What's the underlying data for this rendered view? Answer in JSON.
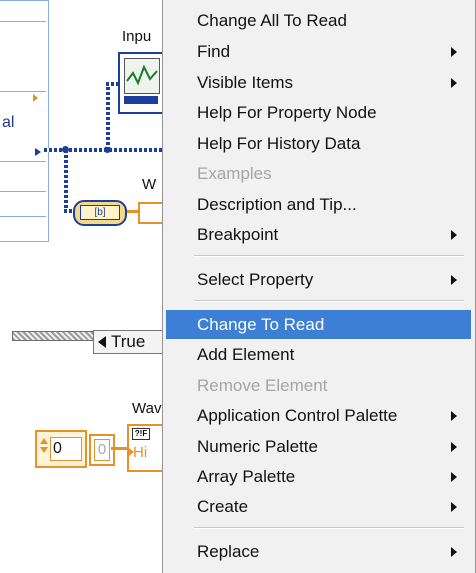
{
  "diagram": {
    "cluster_label": "al",
    "input_label": "Inpu",
    "wa_label_top": "W",
    "case_selector_value": "True",
    "wa_label_bottom": "Wav",
    "numeric_value": "0",
    "index_value": "0",
    "history_tf": "?!F",
    "history_text": "Hi",
    "unbundle_text": "[b]"
  },
  "menu": {
    "items": [
      {
        "label": "Change All To Read",
        "submenu": false,
        "disabled": false,
        "selected": false
      },
      {
        "label": "Find",
        "submenu": true,
        "disabled": false,
        "selected": false
      },
      {
        "label": "Visible Items",
        "submenu": true,
        "disabled": false,
        "selected": false
      },
      {
        "label": "Help For Property Node",
        "submenu": false,
        "disabled": false,
        "selected": false
      },
      {
        "label": "Help For History Data",
        "submenu": false,
        "disabled": false,
        "selected": false
      },
      {
        "label": "Examples",
        "submenu": false,
        "disabled": true,
        "selected": false
      },
      {
        "label": "Description and Tip...",
        "submenu": false,
        "disabled": false,
        "selected": false
      },
      {
        "label": "Breakpoint",
        "submenu": true,
        "disabled": false,
        "selected": false
      },
      {
        "label": "Select Property",
        "submenu": true,
        "disabled": false,
        "selected": false
      },
      {
        "label": "Change To Read",
        "submenu": false,
        "disabled": false,
        "selected": true
      },
      {
        "label": "Add Element",
        "submenu": false,
        "disabled": false,
        "selected": false
      },
      {
        "label": "Remove Element",
        "submenu": false,
        "disabled": true,
        "selected": false
      },
      {
        "label": "Application Control Palette",
        "submenu": true,
        "disabled": false,
        "selected": false
      },
      {
        "label": "Numeric Palette",
        "submenu": true,
        "disabled": false,
        "selected": false
      },
      {
        "label": "Array Palette",
        "submenu": true,
        "disabled": false,
        "selected": false
      },
      {
        "label": "Create",
        "submenu": true,
        "disabled": false,
        "selected": false
      },
      {
        "label": "Replace",
        "submenu": true,
        "disabled": false,
        "selected": false
      }
    ]
  },
  "colors": {
    "selection": "#3c7fd4",
    "wire_blue": "#1c3f9d",
    "wire_orange": "#e8912a",
    "menu_bg": "#f1f1f1"
  }
}
